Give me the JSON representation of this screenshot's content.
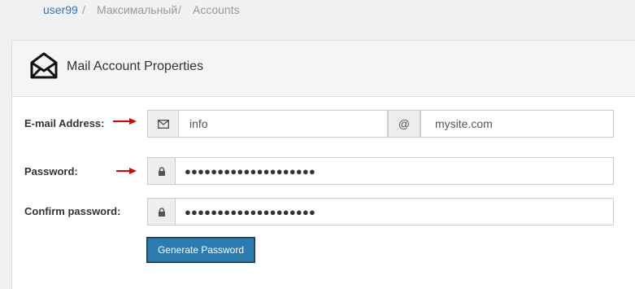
{
  "breadcrumb": {
    "user": "user99",
    "sep1": "/",
    "plan": "Максимальный",
    "sep2": "/",
    "section": "Accounts"
  },
  "panel": {
    "title": "Mail Account Properties",
    "icon": "mail-icon"
  },
  "form": {
    "email_label": "E-mail Address:",
    "email_user": "info",
    "at_sign": "@",
    "email_domain": "mysite.com",
    "password_label": "Password:",
    "password_value": "●●●●●●●●●●●●●●●●●●●●",
    "confirm_label": "Confirm password:",
    "confirm_value": "●●●●●●●●●●●●●●●●●●●●",
    "generate_button": "Generate Password"
  },
  "colors": {
    "link": "#3276b1",
    "button": "#2a7bb0",
    "annotation_arrow": "#e00000"
  }
}
